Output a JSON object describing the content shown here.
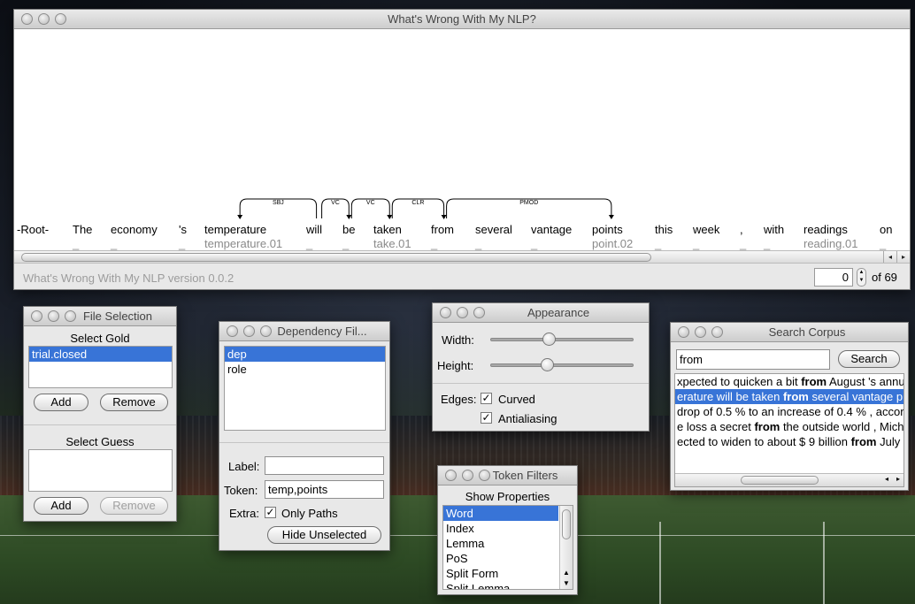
{
  "main_window": {
    "title": "What's Wrong With My NLP?",
    "tokens": [
      {
        "word": "-Root-",
        "sense": ""
      },
      {
        "word": "The",
        "sense": "_"
      },
      {
        "word": "economy",
        "sense": "_"
      },
      {
        "word": "'s",
        "sense": "_"
      },
      {
        "word": "temperature",
        "sense": "temperature.01"
      },
      {
        "word": "will",
        "sense": "_"
      },
      {
        "word": "be",
        "sense": "_"
      },
      {
        "word": "taken",
        "sense": "take.01"
      },
      {
        "word": "from",
        "sense": "_"
      },
      {
        "word": "several",
        "sense": "_"
      },
      {
        "word": "vantage",
        "sense": "_"
      },
      {
        "word": "points",
        "sense": "point.02"
      },
      {
        "word": "this",
        "sense": "_"
      },
      {
        "word": "week",
        "sense": "_"
      },
      {
        "word": ",",
        "sense": "_"
      },
      {
        "word": "with",
        "sense": "_"
      },
      {
        "word": "readings",
        "sense": "reading.01"
      },
      {
        "word": "on",
        "sense": "_"
      }
    ],
    "edges": [
      {
        "label": "SBJ",
        "from": "will",
        "to": "temperature"
      },
      {
        "label": "VC",
        "from": "will",
        "to": "be"
      },
      {
        "label": "VC",
        "from": "be",
        "to": "taken"
      },
      {
        "label": "CLR",
        "from": "taken",
        "to": "from"
      },
      {
        "label": "PMOD",
        "from": "from",
        "to": "points"
      }
    ],
    "version_text": "What's Wrong With My NLP version 0.0.2",
    "page_index": "0",
    "page_total": "of 69",
    "scroll_left": "◂",
    "scroll_right": "▸"
  },
  "file_selection": {
    "title": "File Selection",
    "gold_header": "Select Gold",
    "gold_items": [
      "trial.closed"
    ],
    "guess_header": "Select Guess",
    "add_label": "Add",
    "remove_label": "Remove"
  },
  "dependency_filter": {
    "title": "Dependency Fil...",
    "items": [
      "dep",
      "role"
    ],
    "label_label": "Label:",
    "label_value": "",
    "token_label": "Token:",
    "token_value": "temp,points",
    "extra_label": "Extra:",
    "only_paths_label": "Only Paths",
    "hide_button": "Hide Unselected"
  },
  "appearance": {
    "title": "Appearance",
    "width_label": "Width:",
    "height_label": "Height:",
    "width_level": 0.4,
    "height_level": 0.39,
    "edges_label": "Edges:",
    "curved_label": "Curved",
    "antialiasing_label": "Antialiasing"
  },
  "token_filters": {
    "title": "Token Filters",
    "header": "Show Properties",
    "items": [
      "Word",
      "Index",
      "Lemma",
      "PoS",
      "Split Form",
      "Split Lemma"
    ]
  },
  "search_corpus": {
    "title": "Search Corpus",
    "query": "from",
    "search_button": "Search",
    "results": [
      {
        "pre": "xpected to quicken a bit ",
        "hit": "from",
        "post": " August 's annu"
      },
      {
        "pre": "erature will be taken ",
        "hit": "from",
        "post": " several vantage p"
      },
      {
        "pre": "drop of 0.5 % to an increase of 0.4 % , accor",
        "hit": "",
        "post": ""
      },
      {
        "pre": "e loss a secret ",
        "hit": "from",
        "post": " the outside world , Mich"
      },
      {
        "pre": "ected to widen to about $ 9 billion ",
        "hit": "from",
        "post": " July"
      }
    ]
  },
  "colors": {
    "selection": "#3874d7",
    "window_bg": "#e8e8e8"
  }
}
